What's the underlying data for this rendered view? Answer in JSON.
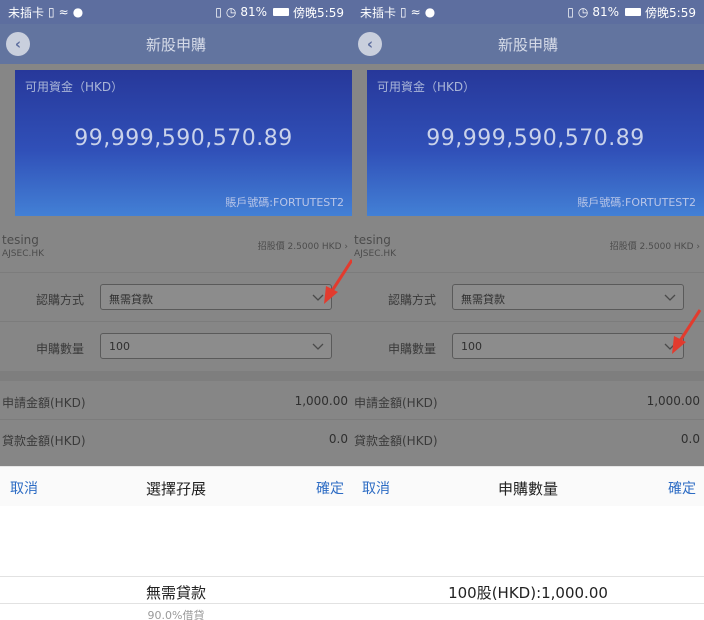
{
  "left": {
    "status": {
      "carrier": "未插卡",
      "battery_text": "81%",
      "time": "傍晚5:59"
    },
    "nav": {
      "title": "新股申購"
    },
    "card": {
      "label": "可用資金（HKD）",
      "amount": "99,999,590,570.89",
      "account": "賬戶號碼:FORTUTEST2"
    },
    "stock": {
      "name": "tesing",
      "code": "AJSEC.HK",
      "price": "招股價 2.5000 HKD"
    },
    "subscribe_method": {
      "label": "認購方式",
      "value": "無需貸款"
    },
    "quantity": {
      "label": "申購數量",
      "value": "100"
    },
    "info": [
      {
        "key": "申請金額(HKD)",
        "value": "1,000.00"
      },
      {
        "key": "貸款金額(HKD)",
        "value": "0.0"
      }
    ],
    "sheet": {
      "cancel": "取消",
      "title": "選擇孖展",
      "confirm": "確定"
    },
    "picker": {
      "option": "無需貸款",
      "next_option": "90.0%借貸"
    }
  },
  "right": {
    "status": {
      "carrier": "未插卡",
      "battery_text": "81%",
      "time": "傍晚5:59"
    },
    "nav": {
      "title": "新股申購"
    },
    "card": {
      "label": "可用資金（HKD）",
      "amount": "99,999,590,570.89",
      "account": "賬戶號碼:FORTUTEST2"
    },
    "stock": {
      "name": "tesing",
      "code": "AJSEC.HK",
      "price": "招股價 2.5000 HKD"
    },
    "subscribe_method": {
      "label": "認購方式",
      "value": "無需貸款"
    },
    "quantity": {
      "label": "申購數量",
      "value": "100"
    },
    "info": [
      {
        "key": "申請金額(HKD)",
        "value": "1,000.00"
      },
      {
        "key": "貸款金額(HKD)",
        "value": "0.0"
      }
    ],
    "sheet": {
      "cancel": "取消",
      "title": "申購數量",
      "confirm": "確定"
    },
    "picker": {
      "option": "100股(HKD):1,000.00"
    }
  },
  "colors": {
    "accent": "#2d6cc4",
    "nav": "#62749f",
    "overlay": "#868686",
    "annotation_arrow": "#e23b2e"
  }
}
